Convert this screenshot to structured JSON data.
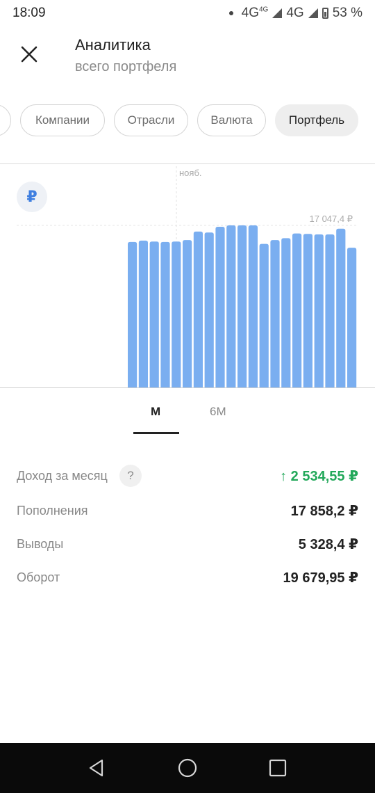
{
  "status_bar": {
    "time": "18:09",
    "network_1": "4G",
    "network_1_sup": "4G",
    "network_2": "4G",
    "battery": "53 %"
  },
  "header": {
    "title": "Аналитика",
    "subtitle": "всего портфеля"
  },
  "chips": [
    {
      "label": "",
      "active": false
    },
    {
      "label": "Компании",
      "active": false
    },
    {
      "label": "Отрасли",
      "active": false
    },
    {
      "label": "Валюта",
      "active": false
    },
    {
      "label": "Портфель",
      "active": true
    }
  ],
  "chart_data": {
    "type": "bar",
    "currency_symbol": "₽",
    "month_marker": "нояб.",
    "max_label": "17 047,4 ₽",
    "max_value": 17047.4,
    "values": [
      15300,
      15450,
      15350,
      15300,
      15350,
      15500,
      16400,
      16300,
      16900,
      17047.4,
      17047.4,
      17047.4,
      15100,
      15500,
      15700,
      16200,
      16150,
      16100,
      16100,
      16700,
      14700
    ],
    "color": "#7aaef0"
  },
  "period_tabs": [
    {
      "label": "М",
      "active": true
    },
    {
      "label": "6М",
      "active": false
    }
  ],
  "stats": [
    {
      "label": "Доход за месяц",
      "value": "2 534,55 ₽",
      "color": "#22a85a",
      "arrow": "↑",
      "help": "?"
    },
    {
      "label": "Пополнения",
      "value": "17 858,2 ₽"
    },
    {
      "label": "Выводы",
      "value": "5 328,4 ₽"
    },
    {
      "label": "Оборот",
      "value": "19 679,95 ₽"
    }
  ]
}
